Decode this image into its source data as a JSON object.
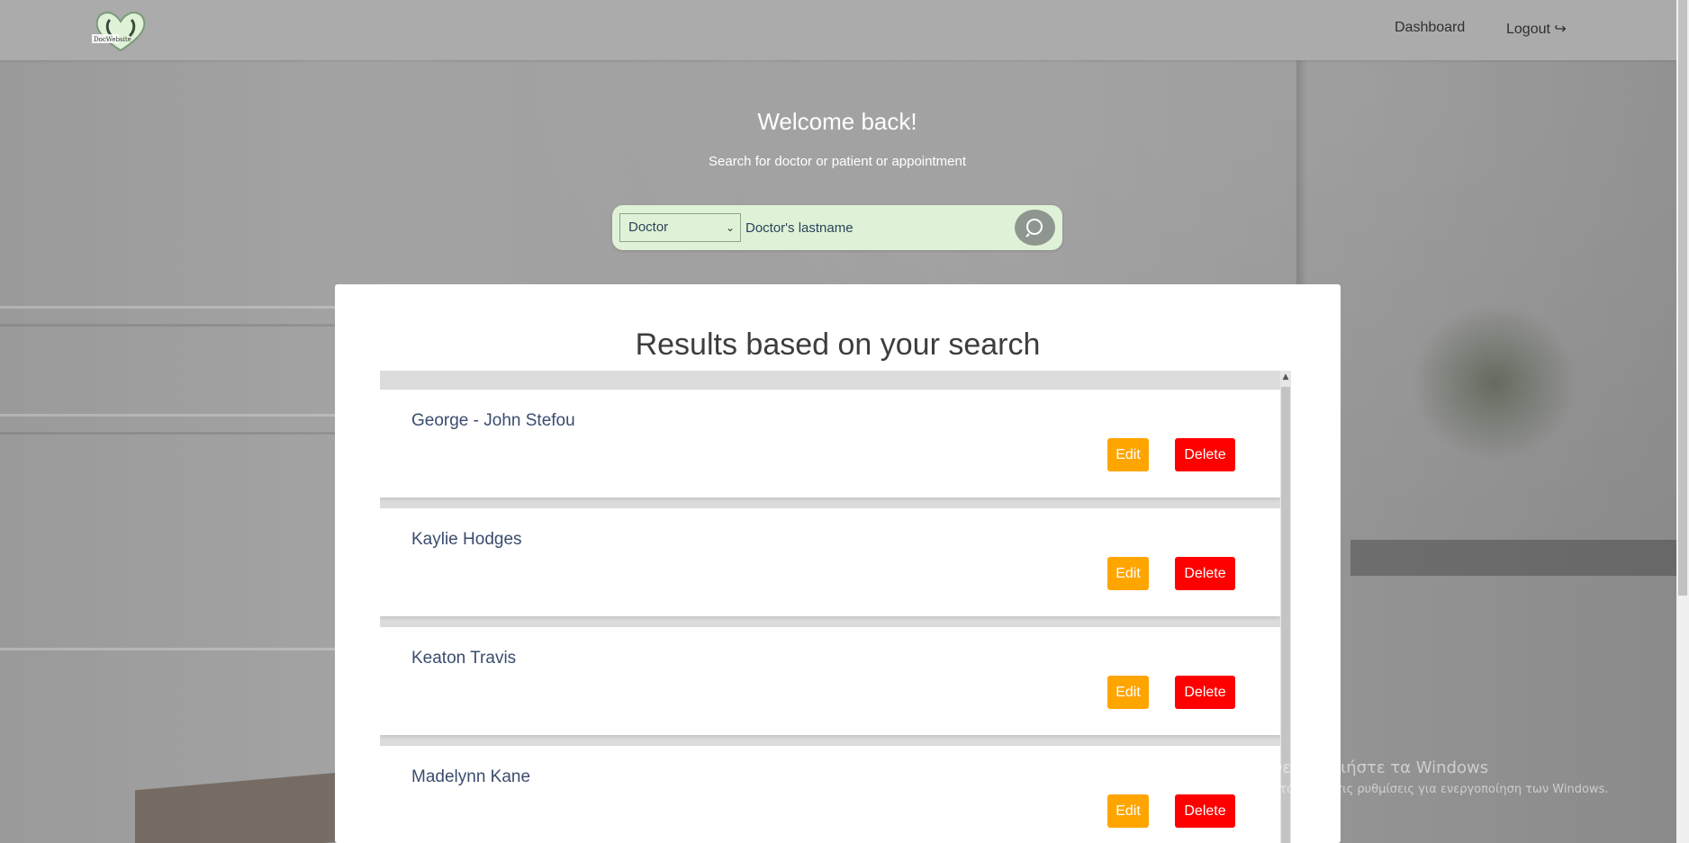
{
  "app": {
    "logo_text": "DocWebsite"
  },
  "nav": {
    "dashboard": "Dashboard",
    "logout": "Logout ↪"
  },
  "hero": {
    "welcome": "Welcome back!",
    "subtitle": "Search for doctor or patient or appointment"
  },
  "search": {
    "type_value": "Doctor",
    "type_options": [
      "Doctor"
    ],
    "input_placeholder": "Doctor's lastname",
    "input_value": "",
    "button_icon": "search-icon"
  },
  "results": {
    "title": "Results based on your search",
    "items": [
      {
        "name": "George - John Stefou",
        "edit": "Edit",
        "delete": "Delete"
      },
      {
        "name": "Kaylie Hodges",
        "edit": "Edit",
        "delete": "Delete"
      },
      {
        "name": "Keaton Travis",
        "edit": "Edit",
        "delete": "Delete"
      },
      {
        "name": "Madelynn Kane",
        "edit": "Edit",
        "delete": "Delete"
      }
    ]
  },
  "watermark": {
    "line1": "Ενεργοποιήστε τα Windows",
    "line2": "Μετάβαση στις ρυθμίσεις για ενεργοποίηση των Windows."
  },
  "colors": {
    "edit": "#ffa500",
    "delete": "#ff0000",
    "search_bg": "#dff2d8",
    "name_text": "#3a4c6e"
  }
}
